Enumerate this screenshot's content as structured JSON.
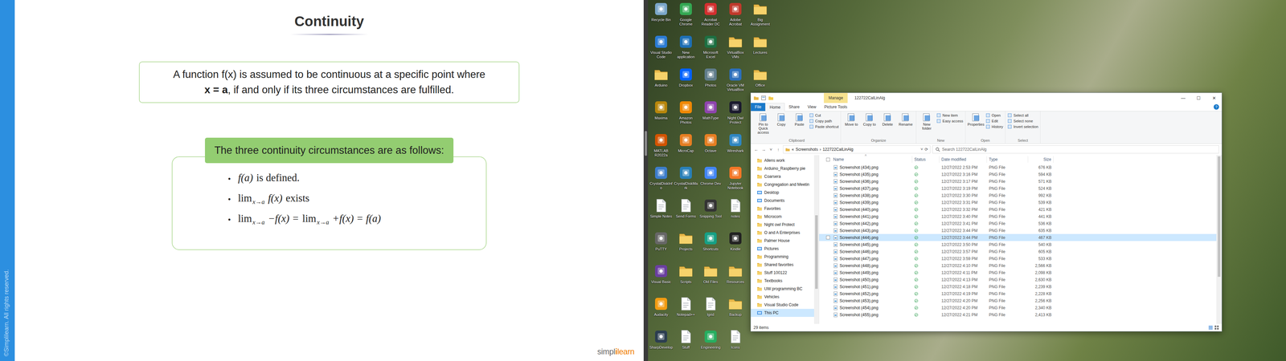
{
  "slide": {
    "title": "Continuity",
    "copyright": "©Simplilearn. All rights reserved.",
    "definition": [
      [
        {
          "text": "A function f(x) is assumed to be continuous at a specific point where",
          "bold": false
        }
      ],
      [
        {
          "text": "x = a",
          "bold": true
        },
        {
          "text": ", if and only if its three circumstances are fulfilled.",
          "bold": false
        }
      ]
    ],
    "conditions_heading": "The three continuity circumstances are as follows:",
    "conditions": [
      {
        "bullet": "•",
        "parts": [
          {
            "kind": "math",
            "text": "f(a)",
            "sub": ""
          },
          {
            "kind": "text",
            "text": "is defined.",
            "sub": ""
          }
        ]
      },
      {
        "bullet": "•",
        "parts": [
          {
            "kind": "lim",
            "text": "lim",
            "sub": "x→a"
          },
          {
            "kind": "math",
            "text": "f(x)",
            "sub": ""
          },
          {
            "kind": "text",
            "text": "exists",
            "sub": ""
          }
        ]
      },
      {
        "bullet": "•",
        "parts": [
          {
            "kind": "lim",
            "text": "lim",
            "sub": "x→a"
          },
          {
            "kind": "math",
            "text": "−f(x) =",
            "sub": ""
          },
          {
            "kind": "lim",
            "text": "lim",
            "sub": "x→a"
          },
          {
            "kind": "math",
            "text": "+f(x) = f(a)",
            "sub": ""
          }
        ]
      }
    ],
    "logo": {
      "left": "simpl",
      "mark": "i",
      "right": "learn"
    }
  },
  "desktop": {
    "icons": [
      {
        "label": "Recycle Bin",
        "kind": "app",
        "color": "#7aa6c8"
      },
      {
        "label": "Visual Studio Code",
        "kind": "app",
        "color": "#2b7bd3"
      },
      {
        "label": "Arduino",
        "kind": "folder",
        "color": "#e8b84a"
      },
      {
        "label": "Maxima",
        "kind": "app",
        "color": "#b8860b"
      },
      {
        "label": "MATLAB R2022a",
        "kind": "app",
        "color": "#d35400"
      },
      {
        "label": "CrystalDiskInfo",
        "kind": "app",
        "color": "#3d7dca"
      },
      {
        "label": "Simple Notes",
        "kind": "file",
        "color": "#ffffff"
      },
      {
        "label": "PuTTY",
        "kind": "app",
        "color": "#666666"
      },
      {
        "label": "Visual Basic",
        "kind": "app",
        "color": "#6a3fa0"
      },
      {
        "label": "Audacity",
        "kind": "app",
        "color": "#f39c12"
      },
      {
        "label": "SharpDevelop",
        "kind": "app",
        "color": "#2c3e50"
      },
      {
        "label": "Google Chrome",
        "kind": "app",
        "color": "#34a853"
      },
      {
        "label": "New application",
        "kind": "app",
        "color": "#1e6fb5"
      },
      {
        "label": "Dropbox",
        "kind": "app",
        "color": "#0061fe"
      },
      {
        "label": "Amazon Photos",
        "kind": "app",
        "color": "#f08804"
      },
      {
        "label": "MicroCap",
        "kind": "app",
        "color": "#e67e22"
      },
      {
        "label": "CrystalDiskMark",
        "kind": "app",
        "color": "#2980b9"
      },
      {
        "label": "Send Forms",
        "kind": "file",
        "color": "#ffffff"
      },
      {
        "label": "Projects",
        "kind": "folder",
        "color": "#e8b84a"
      },
      {
        "label": "Scripts",
        "kind": "folder",
        "color": "#e8b84a"
      },
      {
        "label": "Notepad++",
        "kind": "file",
        "color": "#ffffff"
      },
      {
        "label": "Stuff",
        "kind": "file",
        "color": "#ffffff"
      },
      {
        "label": "Acrobat Reader DC",
        "kind": "app",
        "color": "#d32f2f"
      },
      {
        "label": "Microsoft Excel",
        "kind": "app",
        "color": "#1d6f42"
      },
      {
        "label": "Photos",
        "kind": "app",
        "color": "#607d8b"
      },
      {
        "label": "MathType",
        "kind": "app",
        "color": "#8e44ad"
      },
      {
        "label": "Octave",
        "kind": "app",
        "color": "#e67e22"
      },
      {
        "label": "Chrome Dev",
        "kind": "app",
        "color": "#4285f4"
      },
      {
        "label": "Snipping Tool",
        "kind": "app",
        "color": "#333333"
      },
      {
        "label": "Shortcuts",
        "kind": "app",
        "color": "#16a085"
      },
      {
        "label": "Old Files",
        "kind": "folder",
        "color": "#e8b84a"
      },
      {
        "label": "lgrid",
        "kind": "file",
        "color": "#ffffff"
      },
      {
        "label": "Engineering",
        "kind": "app",
        "color": "#27ae60"
      },
      {
        "label": "Adobe Acrobat",
        "kind": "app",
        "color": "#c0392b"
      },
      {
        "label": "VirtualBox VMs",
        "kind": "folder",
        "color": "#e8b84a"
      },
      {
        "label": "Oracle VM VirtualBox",
        "kind": "app",
        "color": "#2c6fbb"
      },
      {
        "label": "Night Owl Protect",
        "kind": "app",
        "color": "#1a1a2e"
      },
      {
        "label": "Wireshark",
        "kind": "app",
        "color": "#2e86c1"
      },
      {
        "label": "Jupyter Notebook",
        "kind": "app",
        "color": "#f37626"
      },
      {
        "label": "notes",
        "kind": "file",
        "color": "#ffffff"
      },
      {
        "label": "Kindle",
        "kind": "app",
        "color": "#222222"
      },
      {
        "label": "Resources",
        "kind": "folder",
        "color": "#e8b84a"
      },
      {
        "label": "Backup",
        "kind": "folder",
        "color": "#e8b84a"
      },
      {
        "label": "Icons",
        "kind": "file",
        "color": "#ffffff"
      },
      {
        "label": "Big Assignment",
        "kind": "folder",
        "color": "#e8b84a"
      },
      {
        "label": "Lectures",
        "kind": "folder",
        "color": "#e8b84a"
      },
      {
        "label": "Office",
        "kind": "folder",
        "color": "#e8b84a"
      }
    ]
  },
  "explorer": {
    "title": "122722CalLinAlg",
    "context_tab": "Manage",
    "controls": [
      "—",
      "☐",
      "✕"
    ],
    "tabs": [
      {
        "label": "File",
        "selected": false
      },
      {
        "label": "Home",
        "selected": true
      },
      {
        "label": "Share",
        "selected": false
      },
      {
        "label": "View",
        "selected": false
      },
      {
        "label": "Picture Tools",
        "selected": false
      }
    ],
    "help": "?",
    "ribbon": [
      {
        "group": "Clipboard",
        "big": [
          "Pin to Quick access",
          "Copy",
          "Paste"
        ],
        "small": [
          "Cut",
          "Copy path",
          "Paste shortcut"
        ]
      },
      {
        "group": "Organize",
        "big": [
          "Move to",
          "Copy to",
          "Delete",
          "Rename"
        ],
        "small": []
      },
      {
        "group": "New",
        "big": [
          "New folder"
        ],
        "small": [
          "New item",
          "Easy access"
        ]
      },
      {
        "group": "Open",
        "big": [
          "Properties"
        ],
        "small": [
          "Open",
          "Edit",
          "History"
        ]
      },
      {
        "group": "Select",
        "big": [],
        "small": [
          "Select all",
          "Select none",
          "Invert selection"
        ]
      }
    ],
    "nav_buttons": [
      "←",
      "→",
      "˅",
      "↑"
    ],
    "address": {
      "path": [
        "«",
        "Screenshots",
        "›",
        "122722CalLinAlg"
      ],
      "dropdown": "˅",
      "refresh": "⟳"
    },
    "search": {
      "placeholder": "Search 122722CalLinAlg"
    },
    "nav": [
      {
        "label": "Allens work",
        "kind": "folder",
        "selected": false
      },
      {
        "label": "Arduino_Raspberry pie",
        "kind": "folder",
        "selected": false
      },
      {
        "label": "Coarsera",
        "kind": "folder",
        "selected": false
      },
      {
        "label": "Congregation and Meetin",
        "kind": "folder",
        "selected": false
      },
      {
        "label": "Desktop",
        "kind": "special",
        "selected": false
      },
      {
        "label": "Documents",
        "kind": "special",
        "selected": false
      },
      {
        "label": "Favorites",
        "kind": "folder",
        "selected": false
      },
      {
        "label": "Microcom",
        "kind": "folder",
        "selected": false
      },
      {
        "label": "Night owl Protect",
        "kind": "folder",
        "selected": false
      },
      {
        "label": "O and A Enterprises",
        "kind": "folder",
        "selected": false
      },
      {
        "label": "Palmer House",
        "kind": "folder",
        "selected": false
      },
      {
        "label": "Pictures",
        "kind": "special",
        "selected": false
      },
      {
        "label": "Programming",
        "kind": "folder",
        "selected": false
      },
      {
        "label": "Shared favorites",
        "kind": "folder",
        "selected": false
      },
      {
        "label": "Stuff 100122",
        "kind": "folder",
        "selected": false
      },
      {
        "label": "Textbooks",
        "kind": "folder",
        "selected": false
      },
      {
        "label": "UW programming BC",
        "kind": "folder",
        "selected": false
      },
      {
        "label": "Vehicles",
        "kind": "folder",
        "selected": false
      },
      {
        "label": "Visual Studio Code",
        "kind": "folder",
        "selected": false
      },
      {
        "label": "This PC",
        "kind": "special",
        "selected": true
      }
    ],
    "columns": [
      "Name",
      "Status",
      "Date modified",
      "Type",
      "Size"
    ],
    "sort_indicator": "˄",
    "files": [
      {
        "name": "Screenshot (434).png",
        "date": "12/27/2022 2:53 PM",
        "type": "PNG File",
        "size": "676 KB",
        "selected": false,
        "checked": false
      },
      {
        "name": "Screenshot (435).png",
        "date": "12/27/2022 3:16 PM",
        "type": "PNG File",
        "size": "594 KB",
        "selected": false,
        "checked": false
      },
      {
        "name": "Screenshot (436).png",
        "date": "12/27/2022 3:17 PM",
        "type": "PNG File",
        "size": "571 KB",
        "selected": false,
        "checked": false
      },
      {
        "name": "Screenshot (437).png",
        "date": "12/27/2022 3:19 PM",
        "type": "PNG File",
        "size": "524 KB",
        "selected": false,
        "checked": false
      },
      {
        "name": "Screenshot (438).png",
        "date": "12/27/2022 3:30 PM",
        "type": "PNG File",
        "size": "992 KB",
        "selected": false,
        "checked": false
      },
      {
        "name": "Screenshot (439).png",
        "date": "12/27/2022 3:31 PM",
        "type": "PNG File",
        "size": "539 KB",
        "selected": false,
        "checked": false
      },
      {
        "name": "Screenshot (440).png",
        "date": "12/27/2022 3:32 PM",
        "type": "PNG File",
        "size": "421 KB",
        "selected": false,
        "checked": false
      },
      {
        "name": "Screenshot (441).png",
        "date": "12/27/2022 3:40 PM",
        "type": "PNG File",
        "size": "441 KB",
        "selected": false,
        "checked": false
      },
      {
        "name": "Screenshot (442).png",
        "date": "12/27/2022 3:41 PM",
        "type": "PNG File",
        "size": "536 KB",
        "selected": false,
        "checked": false
      },
      {
        "name": "Screenshot (443).png",
        "date": "12/27/2022 3:44 PM",
        "type": "PNG File",
        "size": "635 KB",
        "selected": false,
        "checked": false
      },
      {
        "name": "Screenshot (444).png",
        "date": "12/27/2022 3:44 PM",
        "type": "PNG File",
        "size": "467 KB",
        "selected": true,
        "checked": false
      },
      {
        "name": "Screenshot (445).png",
        "date": "12/27/2022 3:50 PM",
        "type": "PNG File",
        "size": "540 KB",
        "selected": false,
        "checked": false
      },
      {
        "name": "Screenshot (446).png",
        "date": "12/27/2022 3:57 PM",
        "type": "PNG File",
        "size": "605 KB",
        "selected": false,
        "checked": false
      },
      {
        "name": "Screenshot (447).png",
        "date": "12/27/2022 3:59 PM",
        "type": "PNG File",
        "size": "533 KB",
        "selected": false,
        "checked": false
      },
      {
        "name": "Screenshot (448).png",
        "date": "12/27/2022 4:10 PM",
        "type": "PNG File",
        "size": "2,566 KB",
        "selected": false,
        "checked": false
      },
      {
        "name": "Screenshot (449).png",
        "date": "12/27/2022 4:11 PM",
        "type": "PNG File",
        "size": "2,098 KB",
        "selected": false,
        "checked": false
      },
      {
        "name": "Screenshot (450).png",
        "date": "12/27/2022 4:13 PM",
        "type": "PNG File",
        "size": "2,630 KB",
        "selected": false,
        "checked": false
      },
      {
        "name": "Screenshot (451).png",
        "date": "12/27/2022 4:18 PM",
        "type": "PNG File",
        "size": "2,239 KB",
        "selected": false,
        "checked": false
      },
      {
        "name": "Screenshot (452).png",
        "date": "12/27/2022 4:19 PM",
        "type": "PNG File",
        "size": "2,228 KB",
        "selected": false,
        "checked": false
      },
      {
        "name": "Screenshot (453).png",
        "date": "12/27/2022 4:20 PM",
        "type": "PNG File",
        "size": "2,256 KB",
        "selected": false,
        "checked": false
      },
      {
        "name": "Screenshot (454).png",
        "date": "12/27/2022 4:20 PM",
        "type": "PNG File",
        "size": "2,340 KB",
        "selected": false,
        "checked": false
      },
      {
        "name": "Screenshot (455).png",
        "date": "12/27/2022 4:21 PM",
        "type": "PNG File",
        "size": "2,413 KB",
        "selected": false,
        "checked": false
      }
    ],
    "status": "29 items"
  }
}
